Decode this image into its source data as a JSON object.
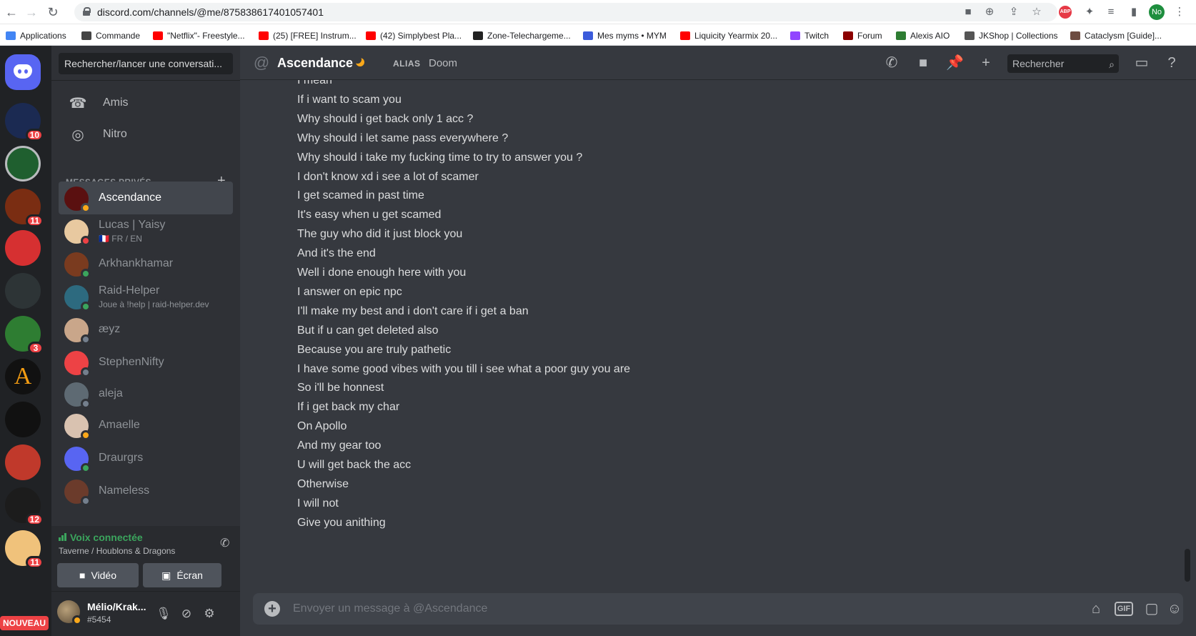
{
  "browser": {
    "url": "discord.com/channels/@me/875838617401057401",
    "profile_initials": "No",
    "abp_label": "ABP",
    "bookmarks": [
      {
        "label": "Applications",
        "color": "#4285f4"
      },
      {
        "label": "Commande",
        "color": "#444444"
      },
      {
        "label": "\"Netflix\"- Freestyle...",
        "color": "#ff0000"
      },
      {
        "label": "(25) [FREE] Instrum...",
        "color": "#ff0000"
      },
      {
        "label": "(42) Simplybest Pla...",
        "color": "#ff0000"
      },
      {
        "label": "Zone-Telechargeme...",
        "color": "#222222"
      },
      {
        "label": "Mes myms • MYM",
        "color": "#3b5bdb"
      },
      {
        "label": "Liquicity Yearmix 20...",
        "color": "#ff0000"
      },
      {
        "label": "Twitch",
        "color": "#9146ff"
      },
      {
        "label": "Forum",
        "color": "#8b0000"
      },
      {
        "label": "Alexis AIO",
        "color": "#2e7d32"
      },
      {
        "label": "JKShop | Collections",
        "color": "#555555"
      },
      {
        "label": "Cataclysm [Guide]...",
        "color": "#6d4c41"
      }
    ]
  },
  "guilds": [
    {
      "color": "#1b2a52",
      "badge": "10"
    },
    {
      "color": "#1f5f2f",
      "badge": ""
    },
    {
      "color": "#7a2d12",
      "badge": "11"
    },
    {
      "color": "#d63031",
      "badge": ""
    },
    {
      "color": "#2d3436",
      "badge": ""
    },
    {
      "color": "#2e7d32",
      "badge": "3"
    },
    {
      "color": "#111111",
      "badge": ""
    },
    {
      "color": "#111111",
      "badge": ""
    },
    {
      "color": "#c0392b",
      "badge": ""
    },
    {
      "color": "#1c1c1c",
      "badge": "12"
    },
    {
      "color": "#f0c27b",
      "badge": "11"
    }
  ],
  "guild_labels": {
    "a_letter": "A",
    "nouveau": "NOUVEAU"
  },
  "sidebar": {
    "search_placeholder": "Rechercher/lancer une conversati...",
    "nav": [
      {
        "label": "Amis",
        "icon": "friends-icon"
      },
      {
        "label": "Nitro",
        "icon": "nitro-icon"
      }
    ],
    "dm_header": "MESSAGES PRIVÉS",
    "dms": [
      {
        "name": "Ascendance",
        "sub": "",
        "status": "idle",
        "avatar_color": "#5a1010"
      },
      {
        "name": "Lucas | Yaisy",
        "sub": "🇫🇷 FR / EN",
        "status": "dnd",
        "avatar_color": "#e8c9a0"
      },
      {
        "name": "Arkhankhamar",
        "sub": "",
        "status": "online",
        "avatar_color": "#7a3b1f"
      },
      {
        "name": "Raid-Helper",
        "sub": "Joue à !help | raid-helper.dev",
        "status": "online",
        "avatar_color": "#2d6a7f"
      },
      {
        "name": "æyz",
        "sub": "",
        "status": "offline",
        "avatar_color": "#c9a68a"
      },
      {
        "name": "StephenNifty",
        "sub": "",
        "status": "offline",
        "avatar_color": "#ed4245"
      },
      {
        "name": "aleja",
        "sub": "",
        "status": "offline",
        "avatar_color": "#5e6a73"
      },
      {
        "name": "Amaelle",
        "sub": "",
        "status": "idle",
        "avatar_color": "#d9c2b0"
      },
      {
        "name": "Draurgrs",
        "sub": "",
        "status": "online",
        "avatar_color": "#5865f2"
      },
      {
        "name": "Nameless",
        "sub": "",
        "status": "offline",
        "avatar_color": "#6b3b2b"
      }
    ]
  },
  "voice": {
    "status": "Voix connectée",
    "channel": "Taverne / Houblons & Dragons",
    "video_label": "Vidéo",
    "screen_label": "Écran"
  },
  "user": {
    "name": "Mélio/Krak...",
    "tag": "#5454"
  },
  "channel": {
    "title": "Ascendance",
    "alias_label": "ALIAS",
    "alias_value": "Doom",
    "search_placeholder": "Rechercher"
  },
  "messages": [
    "I mean",
    "If i want to scam you",
    "Why should i get back only 1 acc ?",
    "Why should i let same pass everywhere ?",
    "Why should i take my fucking time to try to answer you ?",
    "I don't know xd i see a lot of scamer",
    "I get scamed in past time",
    "It's easy when u get scamed",
    "The guy who did it just block you",
    "And it's the end",
    "Well i done enough here with you",
    "I answer on epic npc",
    "I'll make my best and i don't care if i get a ban",
    "But if u can get deleted also",
    "Because you are truly pathetic",
    "I have some good vibes with you till i see what a poor guy you are",
    "So i'll be honnest",
    "If i get back my char",
    "On Apollo",
    "And my gear too",
    "U will get back the acc",
    "Otherwise",
    "I will not",
    "Give you anithing"
  ],
  "composer": {
    "placeholder": "Envoyer un message à @Ascendance",
    "gif_label": "GIF"
  },
  "status_colors": {
    "online": "#3ba55d",
    "idle": "#faa81a",
    "dnd": "#ed4245",
    "offline": "#747f8d"
  }
}
